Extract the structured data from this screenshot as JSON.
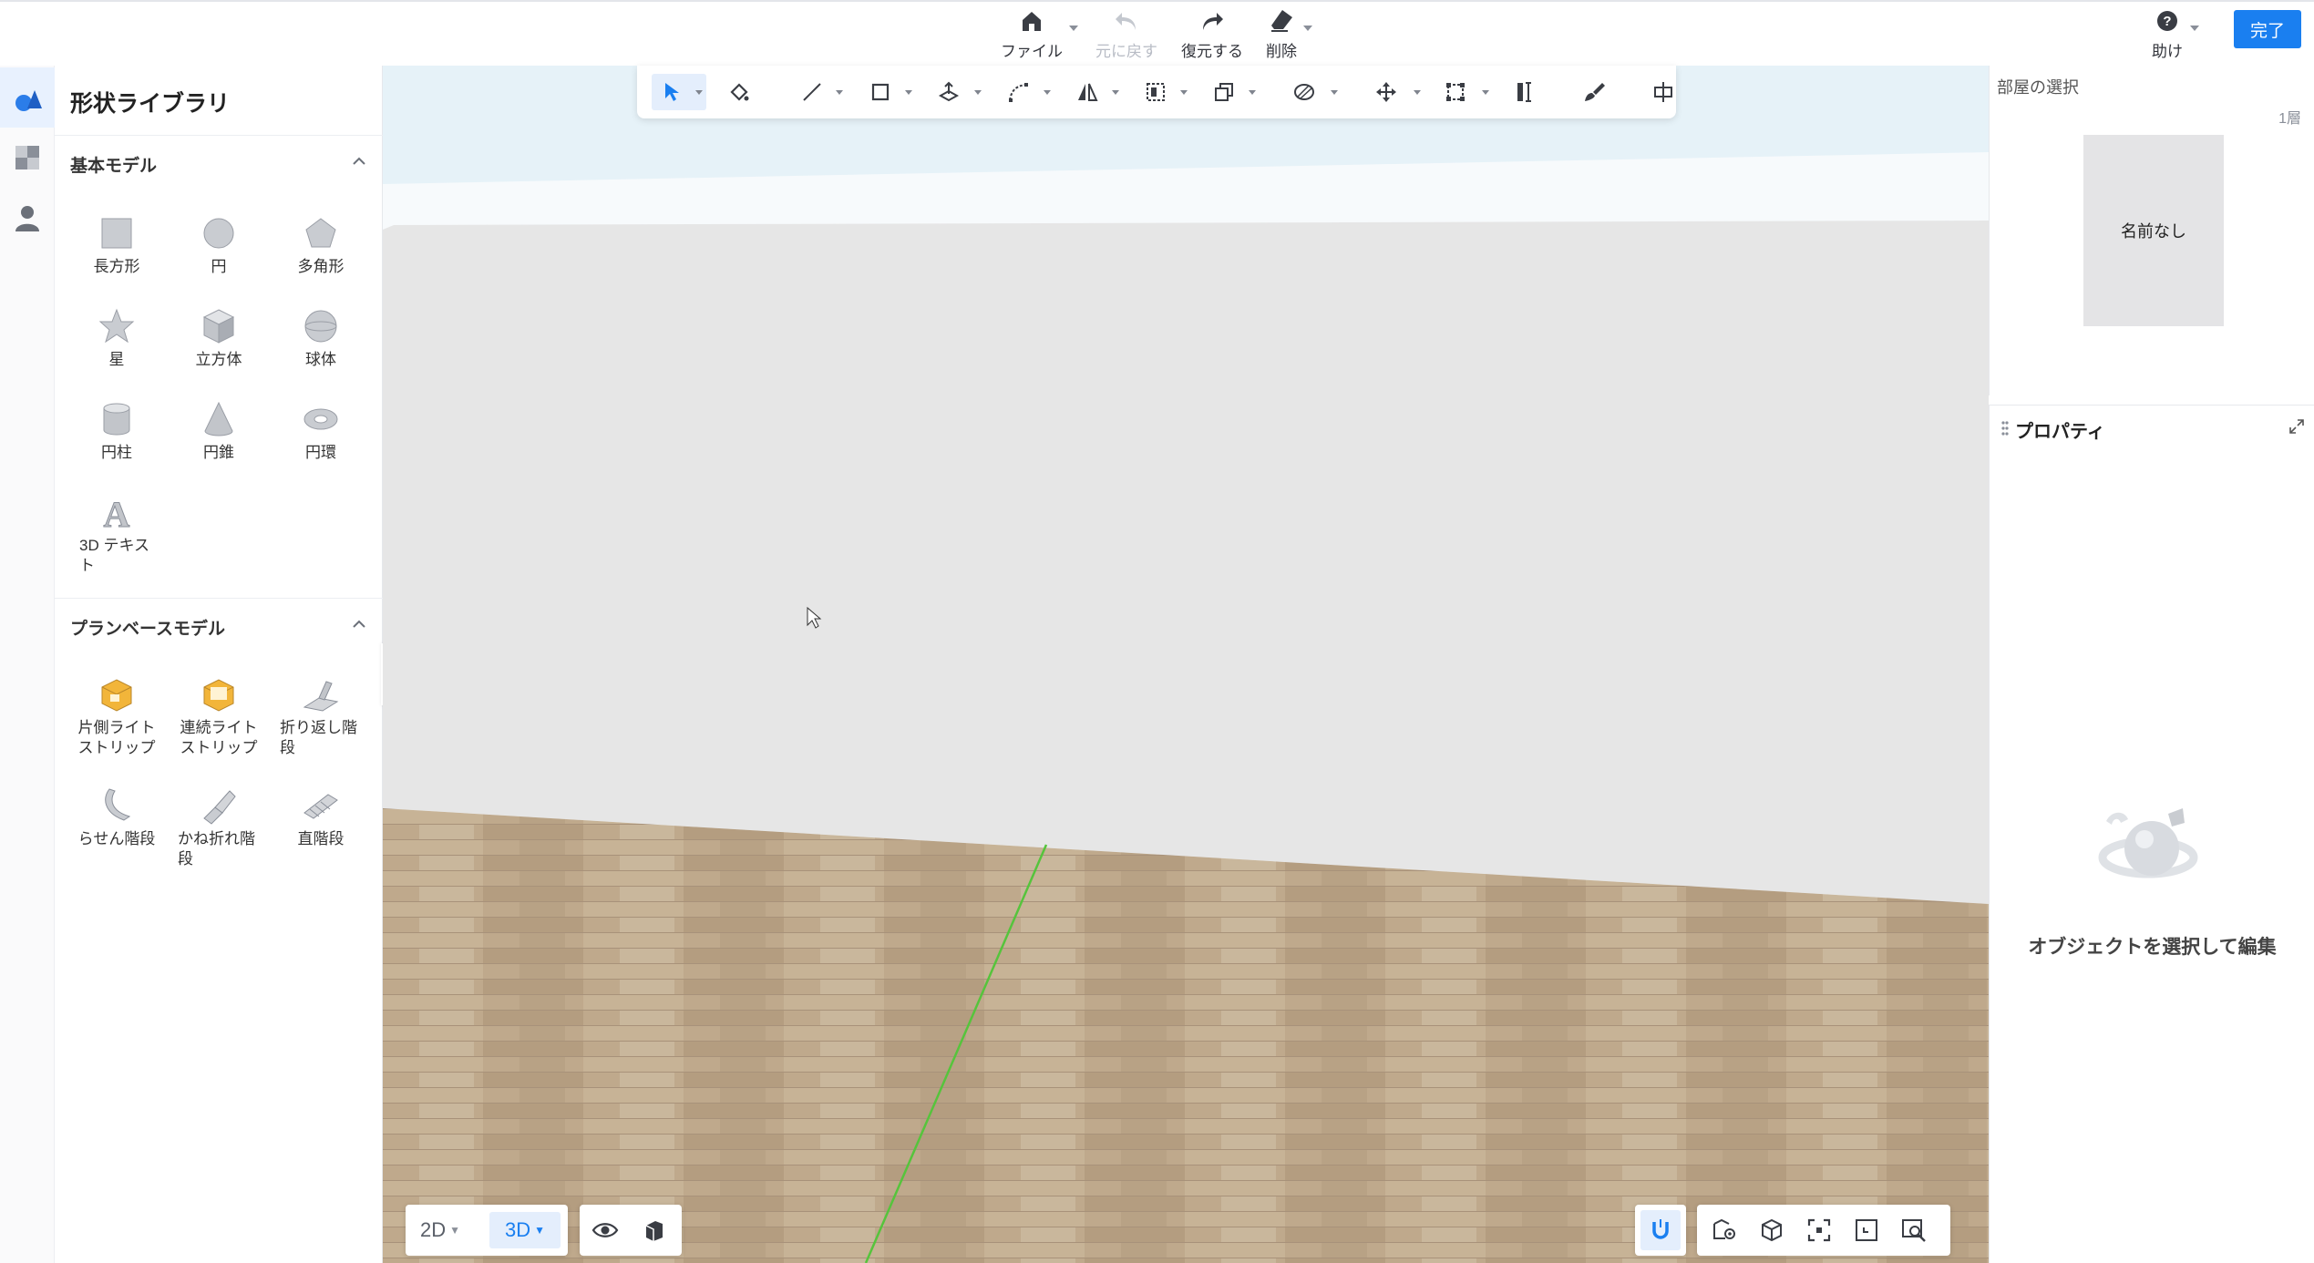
{
  "topbar": {
    "file_label": "ファイル",
    "undo_label": "元に戻す",
    "redo_label": "復元する",
    "delete_label": "削除",
    "help_label": "助け",
    "done_label": "完了"
  },
  "library": {
    "title": "形状ライブラリ",
    "basic_section": "基本モデル",
    "basic_items": [
      "長方形",
      "円",
      "多角形",
      "星",
      "立方体",
      "球体",
      "円柱",
      "円錐",
      "円環",
      "3D テキスト"
    ],
    "plan_section": "プランベースモデル",
    "plan_items": [
      "片側ライトストリップ",
      "連続ライトストリップ",
      "折り返し階段",
      "らせん階段",
      "かね折れ階段",
      "直階段"
    ]
  },
  "view": {
    "mode_2d": "2D",
    "mode_3d": "3D"
  },
  "room": {
    "title": "部屋の選択",
    "floor": "1層",
    "room_name": "名前なし"
  },
  "properties": {
    "title": "プロパティ",
    "empty_text": "オブジェクトを選択して編集"
  },
  "colors": {
    "accent": "#1a7ff0",
    "floor_wood": "#bfa98c",
    "wall": "#e6e6e6",
    "sky": "#e9f4fa",
    "axis_green": "#56c43c"
  }
}
